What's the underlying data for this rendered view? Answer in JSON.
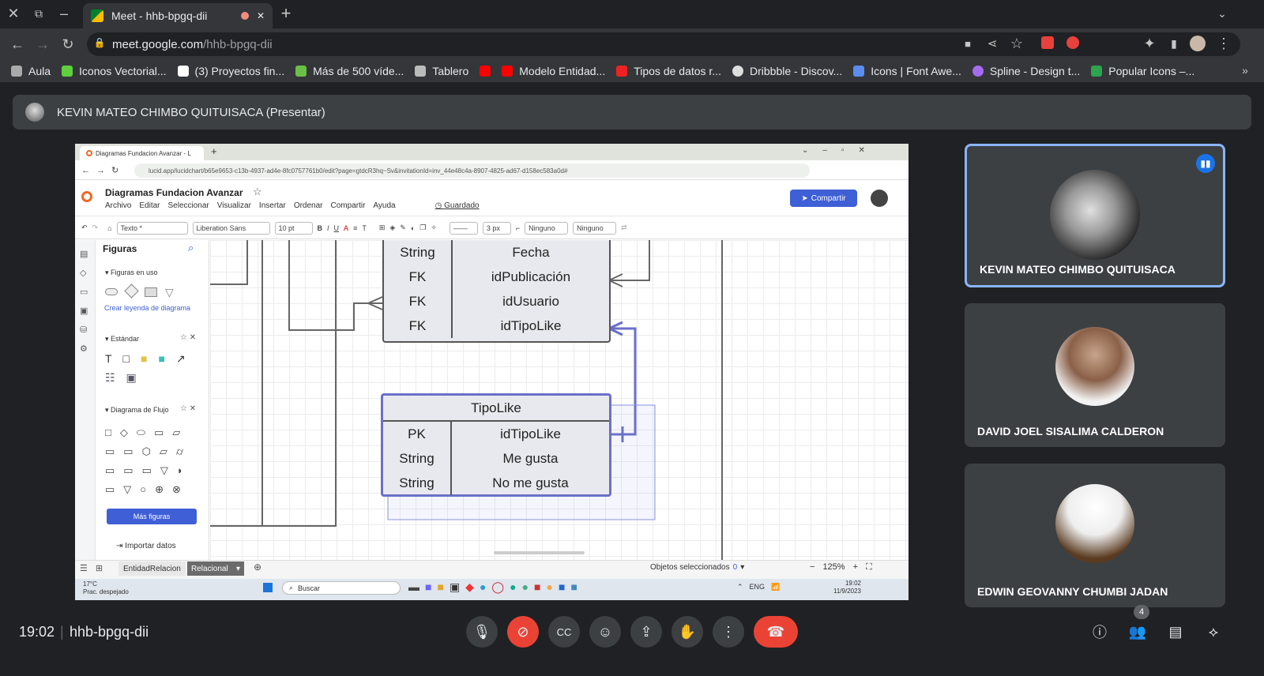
{
  "browser": {
    "tab_title": "Meet - hhb-bpgq-dii",
    "url_host": "meet.google.com",
    "url_path": "/hhb-bpgq-dii",
    "bookmarks": [
      "Aula",
      "Iconos Vectorial...",
      "(3) Proyectos fin...",
      "Más de 500 víde...",
      "Tablero",
      "",
      "Modelo Entidad...",
      "Tipos de datos r...",
      "Dribbble - Discov...",
      "Icons | Font Awe...",
      "Spline - Design t...",
      "Popular Icons –..."
    ]
  },
  "presenter": {
    "label": "KEVIN MATEO CHIMBO QUITUISACA (Presentar)"
  },
  "lucid": {
    "tab_title": "Diagramas Fundacion Avanzar - L",
    "url": "lucid.app/lucidchart/b65e9653-c13b-4937-ad4e-8fc0757761b0/edit?page=gtdcR3hq~Sv&invitationId=inv_44e48c4a-8907-4825-ad67-d158ec583a0d#",
    "doc_title": "Diagramas Fundacion Avanzar",
    "menu": [
      "Archivo",
      "Editar",
      "Seleccionar",
      "Visualizar",
      "Insertar",
      "Ordenar",
      "Compartir",
      "Ayuda"
    ],
    "saved": "Guardado",
    "share": "Compartir",
    "format": {
      "text_style": "Texto *",
      "font": "Liberation Sans",
      "size": "10 pt",
      "line_width": "3 px",
      "arrow_start": "Ninguno",
      "arrow_end": "Ninguno"
    },
    "sidebar": {
      "title": "Figuras",
      "in_use": "Figuras en uso",
      "legend_link": "Crear leyenda de diagrama",
      "standard": "Estándar",
      "flow": "Diagrama de Flujo",
      "more": "Más figuras",
      "import": "Importar datos"
    },
    "table_top": [
      {
        "k": "String",
        "v": "Fecha"
      },
      {
        "k": "FK",
        "v": "idPublicación"
      },
      {
        "k": "FK",
        "v": "idUsuario"
      },
      {
        "k": "FK",
        "v": "idTipoLike"
      }
    ],
    "table_tipolike": {
      "title": "TipoLike",
      "rows": [
        {
          "k": "PK",
          "v": "idTipoLike"
        },
        {
          "k": "String",
          "v": "Me gusta"
        },
        {
          "k": "String",
          "v": "No me gusta"
        }
      ]
    },
    "bottom": {
      "page1": "EntidadRelacion",
      "page2": "Relacional",
      "selected_label": "Objetos seleccionados",
      "selected_count": "0",
      "zoom": "125%"
    },
    "taskbar": {
      "temp": "17°C",
      "weather": "Prac. despejado",
      "search": "Buscar",
      "lang": "ENG",
      "time": "19:02",
      "date": "11/9/2023"
    }
  },
  "participants": [
    {
      "name": "KEVIN MATEO CHIMBO QUITUISACA"
    },
    {
      "name": "DAVID JOEL SISALIMA CALDERON"
    },
    {
      "name": "EDWIN GEOVANNY CHUMBI JADAN"
    }
  ],
  "meeting": {
    "time": "19:02",
    "code": "hhb-bpgq-dii",
    "people_count": "4"
  }
}
